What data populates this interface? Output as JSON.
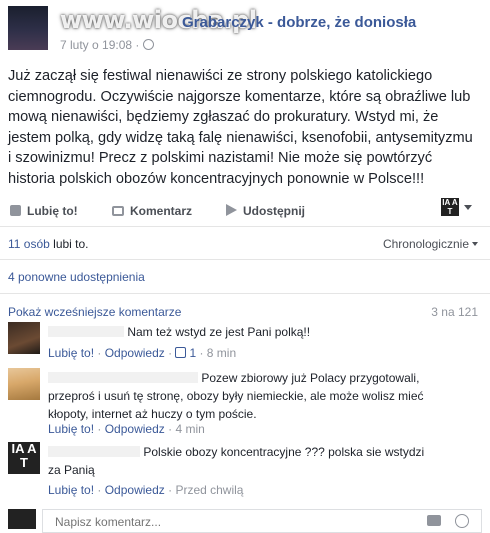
{
  "post": {
    "watermark": "www.wiocha.pl",
    "author_title": "Grabarczyk - dobrze, że doniosła",
    "timestamp": "7 luty o 19:08 ·",
    "body": "Już zaczął się festiwal nienawiści ze strony polskiego katolickiego ciemnogrodu. Oczywiście najgorsze komentarze, które są obraźliwe lub mową nienawiści, będziemy zgłaszać do prokuratury. Wstyd mi, że jestem polką, gdy widzę taką falę nienawiści, ksenofobii, antysemityzmu i szowinizmu! Precz z polskimi nazistami! Nie może się powtórzyć historia polskich obozów koncentracyjnych ponownie w Polsce!!!"
  },
  "actions": {
    "like": "Lubię to!",
    "comment": "Komentarz",
    "share": "Udostępnij",
    "mini_avatar": "IA A T"
  },
  "summary": {
    "likes_count": "11 osób",
    "likes_suffix": "lubi to.",
    "sort": "Chronologicznie",
    "shares": "4 ponowne udostępnienia",
    "show_more": "Pokaż wcześniejsze komentarze",
    "comment_count": "3 na 121"
  },
  "comments": [
    {
      "text": "Nam też wstyd ze jest Pani polką!!",
      "like": "Lubię to!",
      "reply": "Odpowiedz",
      "likes": "1",
      "time": "8 min"
    },
    {
      "text": "Pozew zbiorowy już Polacy przygotowali, przeproś i usuń tę stronę, obozy były niemieckie, ale może wolisz mieć kłopoty, internet aż huczy o tym poście.",
      "like": "Lubię to!",
      "reply": "Odpowiedz",
      "time": "4 min"
    },
    {
      "text": "Polskie obozy koncentracyjne ??? polska sie wstydzi za Panią",
      "like": "Lubię to!",
      "reply": "Odpowiedz",
      "time": "Przed chwilą"
    }
  ],
  "comment_input": {
    "placeholder": "Napisz komentarz..."
  },
  "colors": {
    "link": "#3b5998",
    "muted": "#90949c",
    "text": "#1d2129"
  }
}
